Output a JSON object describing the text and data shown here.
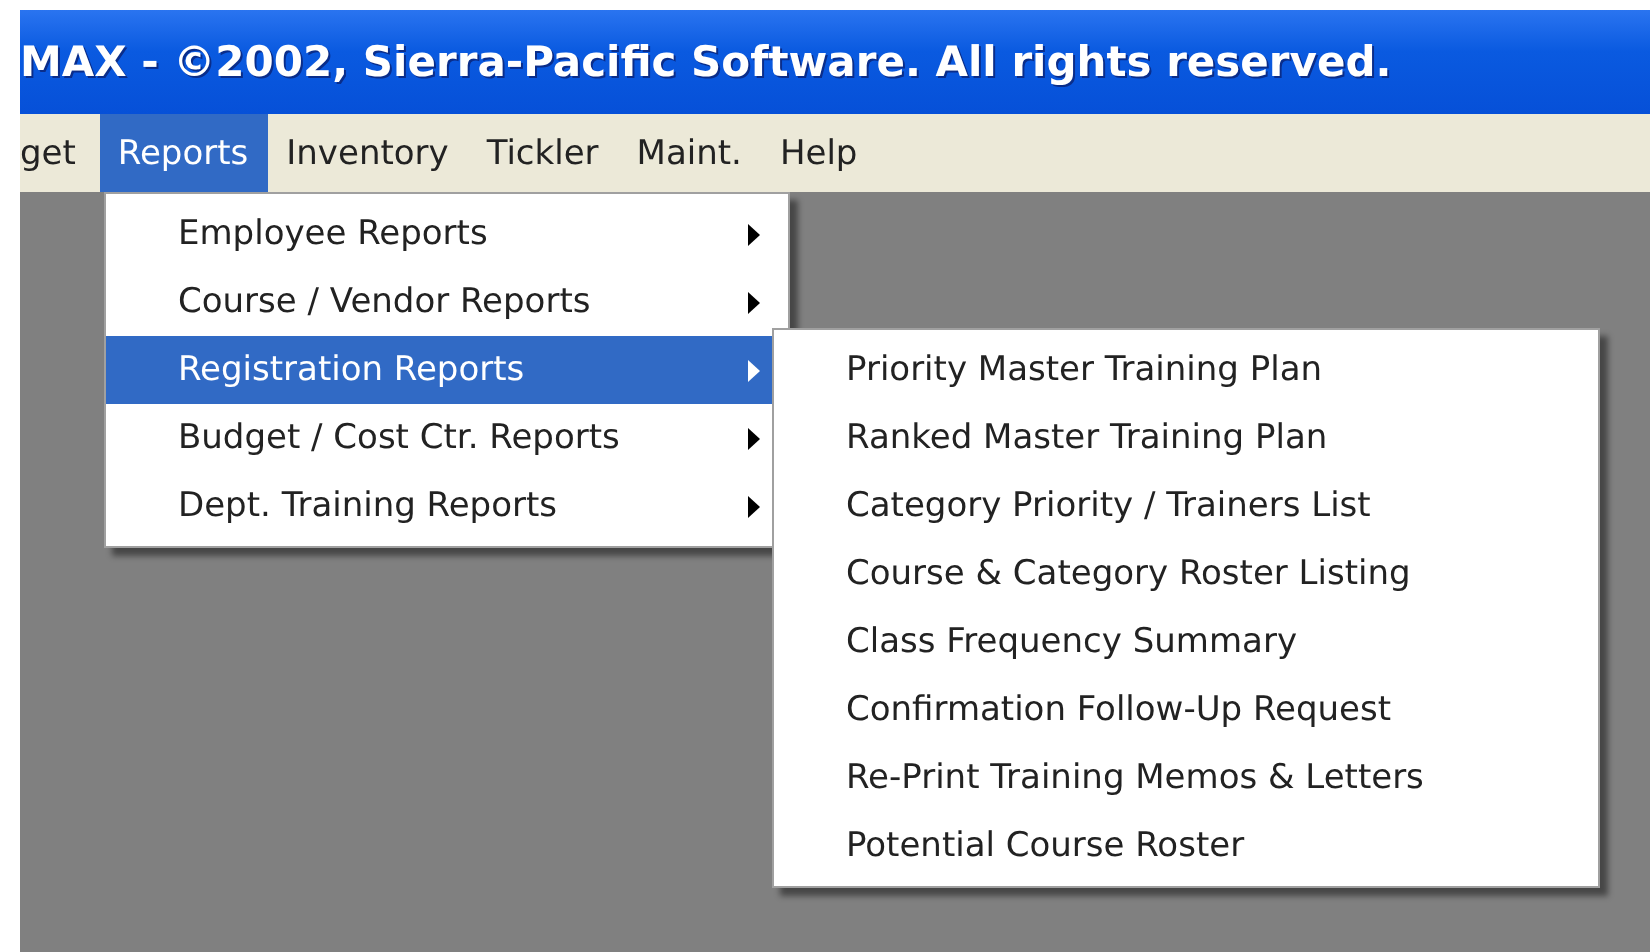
{
  "window": {
    "title": "MAX - ©2002, Sierra-Pacific Software. All rights reserved."
  },
  "menu_bar": [
    {
      "label": "get",
      "selected": false
    },
    {
      "label": "Reports",
      "selected": true
    },
    {
      "label": "Inventory",
      "selected": false
    },
    {
      "label": "Tickler",
      "selected": false
    },
    {
      "label": "Maint.",
      "selected": false
    },
    {
      "label": "Help",
      "selected": false
    }
  ],
  "reports_menu": [
    {
      "label": "Employee Reports",
      "kind": "submenu",
      "selected": false
    },
    {
      "label": "Course / Vendor Reports",
      "kind": "submenu",
      "selected": false
    },
    {
      "label": "Registration Reports",
      "kind": "submenu",
      "selected": true
    },
    {
      "label": "Budget / Cost Ctr. Reports",
      "kind": "submenu",
      "selected": false
    },
    {
      "label": "Dept. Training Reports",
      "kind": "submenu",
      "selected": false
    }
  ],
  "registration_submenu": [
    {
      "label": "Priority Master Training Plan",
      "selected": false
    },
    {
      "label": "Ranked Master Training Plan",
      "selected": false
    },
    {
      "label": "Category Priority / Trainers List",
      "selected": false
    },
    {
      "label": "Course & Category Roster Listing",
      "selected": false
    },
    {
      "label": "Class Frequency Summary",
      "selected": false
    },
    {
      "label": "Confirmation Follow-Up Request",
      "selected": false
    },
    {
      "label": "Re-Print Training Memos & Letters",
      "selected": false
    },
    {
      "label": "Potential Course Roster",
      "selected": false
    }
  ]
}
